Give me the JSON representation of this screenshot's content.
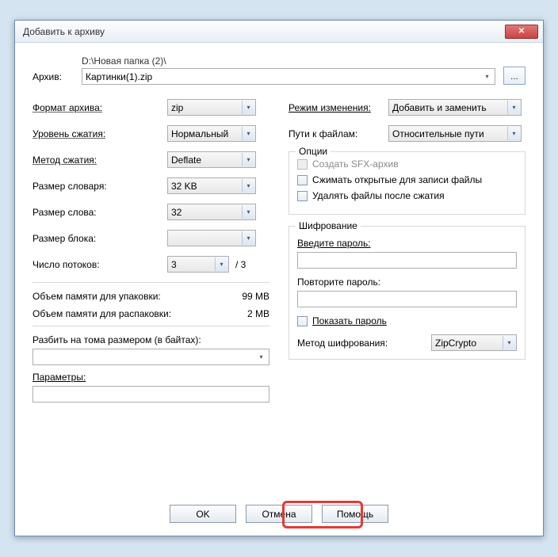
{
  "title": "Добавить к архиву",
  "archive": {
    "label": "Архив:",
    "path": "D:\\Новая папка (2)\\",
    "filename": "Картинки(1).zip",
    "browse": "..."
  },
  "left": {
    "format": {
      "label": "Формат архива:",
      "value": "zip"
    },
    "level": {
      "label": "Уровень сжатия:",
      "value": "Нормальный"
    },
    "method": {
      "label": "Метод сжатия:",
      "value": "Deflate"
    },
    "dict": {
      "label": "Размер словаря:",
      "value": "32 KB"
    },
    "word": {
      "label": "Размер слова:",
      "value": "32"
    },
    "block": {
      "label": "Размер блока:",
      "value": ""
    },
    "threads": {
      "label": "Число потоков:",
      "value": "3",
      "max": "/ 3"
    },
    "mem_pack": {
      "label": "Объем памяти для упаковки:",
      "value": "99 MB"
    },
    "mem_unpack": {
      "label": "Объем памяти для распаковки:",
      "value": "2 MB"
    },
    "split": {
      "label": "Разбить на тома размером (в байтах):"
    },
    "params": {
      "label": "Параметры:"
    }
  },
  "right": {
    "update": {
      "label": "Режим изменения:",
      "value": "Добавить и заменить"
    },
    "paths": {
      "label": "Пути к файлам:",
      "value": "Относительные пути"
    },
    "options": {
      "legend": "Опции",
      "sfx": "Создать SFX-архив",
      "compress_open": "Сжимать открытые для записи файлы",
      "delete_after": "Удалять файлы после сжатия"
    },
    "encryption": {
      "legend": "Шифрование",
      "enter_pwd": "Введите пароль:",
      "repeat_pwd": "Повторите пароль:",
      "show_pwd": "Показать пароль",
      "method_label": "Метод шифрования:",
      "method_value": "ZipCrypto"
    }
  },
  "buttons": {
    "ok": "OK",
    "cancel": "Отмена",
    "help": "Помощь"
  }
}
